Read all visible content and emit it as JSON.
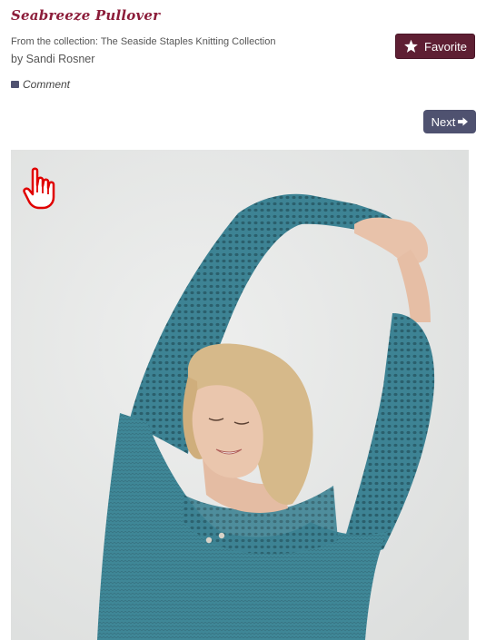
{
  "pattern": {
    "title": "Seabreeze Pullover",
    "collection_line": "From the collection: The Seaside Staples Knitting Collection",
    "author_line": "by Sandi Rosner"
  },
  "actions": {
    "comment_label": "Comment",
    "favorite_label": "Favorite",
    "next_label": "Next"
  },
  "icons": {
    "comment": "comment-icon",
    "favorite": "star-icon",
    "next": "arrow-right-icon",
    "cursor": "hand-pointer-icon"
  },
  "colors": {
    "title": "#8c1d3a",
    "favorite_bg": "#5e1f33",
    "next_bg": "#4f5270",
    "cursor": "#e00000"
  }
}
